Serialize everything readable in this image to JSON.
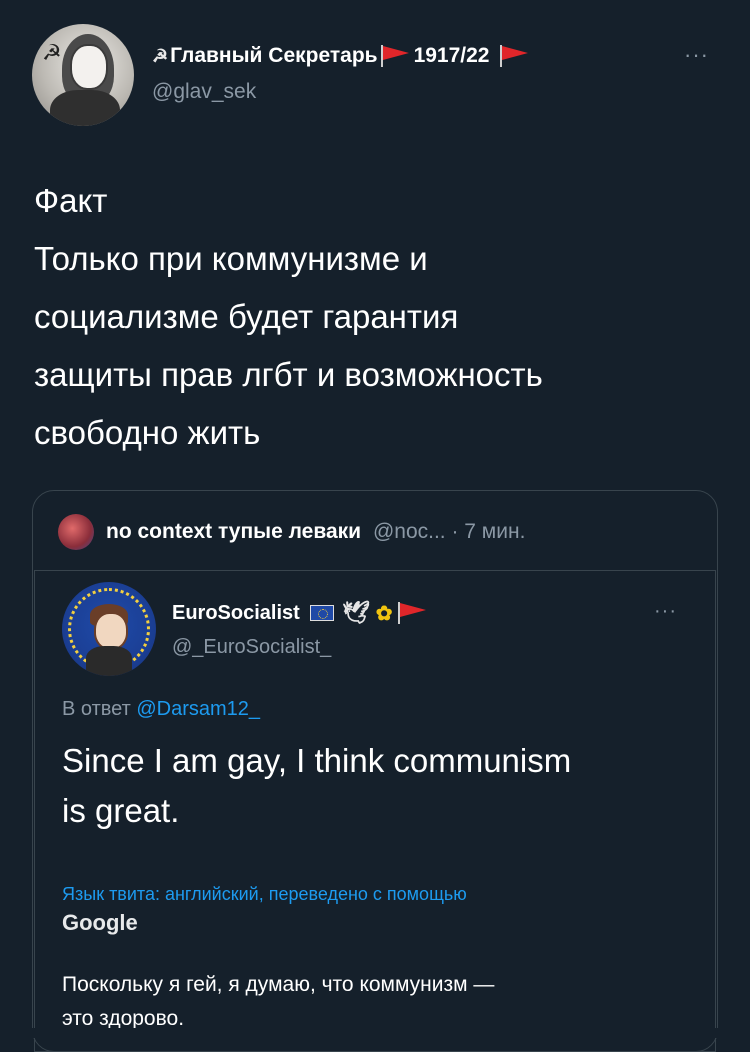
{
  "tweet": {
    "author_name": "Главный Секретарь",
    "author_suffix": "1917/22",
    "handle": "@glav_sek",
    "more": "···",
    "text_lines": [
      "Факт",
      "Только при коммунизме и",
      "социализме будет гарантия",
      "защиты прав лгбт и возможность",
      "свободно жить"
    ]
  },
  "quote": {
    "author_name": "no context тупые леваки",
    "handle_time": "@noc... · 7 мин."
  },
  "inner_tweet": {
    "author_name": "EuroSocialist",
    "handle": "@_EuroSocialist_",
    "more": "···",
    "reply_prefix": "В ответ",
    "reply_mention": "@Darsam12_",
    "text_lines": [
      "Since I am gay, I think communism",
      "is great."
    ],
    "translated_label": "Язык твита: английский, переведено с помощью",
    "google": "Google",
    "translation_lines": [
      "Поскольку я гей, я думаю, что коммунизм —",
      "это здорово."
    ]
  },
  "icons": {
    "flag": "red-flag-icon",
    "sickle": "hammer-sickle-icon",
    "dove": "dove-icon",
    "sunflower": "sunflower-icon",
    "eu_flag": "eu-flag-icon"
  },
  "colors": {
    "background": "#15202b",
    "secondary_text": "#8b98a5",
    "accent": "#1d9bf0",
    "border": "#38444d",
    "flag_red": "#e0262a"
  }
}
